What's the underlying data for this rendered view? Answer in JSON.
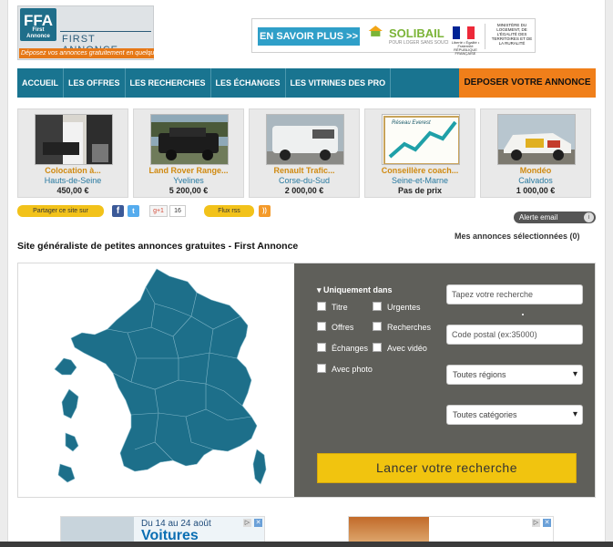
{
  "header": {
    "logo_letters": "FFA",
    "logo_small": "First Annonce",
    "logo_name": "FIRST ANNONCE",
    "logo_tagline": "Déposez vos annonces gratuitement en quelques clics",
    "banner_button": "EN SAVOIR PLUS >>",
    "banner_brand": "SOLIBAIL",
    "banner_brand_sub": "POUR LOGER SANS SOUCI",
    "banner_flag_text": "Liberté • Égalité • Fraternité RÉPUBLIQUE FRANÇAISE",
    "banner_ministry": "MINISTÈRE DU LOGEMENT, DE L'ÉGALITÉ DES TERRITOIRES ET DE LA RURALITÉ"
  },
  "nav": {
    "items": [
      "ACCUEIL",
      "LES OFFRES",
      "LES RECHERCHES",
      "LES ÉCHANGES",
      "LES VITRINES DES PRO"
    ],
    "cta": "DEPOSER VOTRE ANNONCE"
  },
  "listings": [
    {
      "title": "Colocation à...",
      "region": "Hauts-de-Seine",
      "price": "450,00 €"
    },
    {
      "title": "Land Rover Range...",
      "region": "Yvelines",
      "price": "5 200,00 €"
    },
    {
      "title": "Renault Trafic...",
      "region": "Corse-du-Sud",
      "price": "2 000,00 €"
    },
    {
      "title": "Conseillère coach...",
      "region": "Seine-et-Marne",
      "price": "Pas de prix"
    },
    {
      "title": "Mondéo",
      "region": "Calvados",
      "price": "1 000,00 €"
    }
  ],
  "listing_image_text": "Réseau Everest",
  "share": {
    "share_label": "Partager ce site sur",
    "fb": "f",
    "tw": "t",
    "gplus": "g+1",
    "gplus_count": "16",
    "rss_label": "Flux rss",
    "alert_label": "Alerte email",
    "alert_icon": "i"
  },
  "selected_link": "Mes annonces sélectionnées (0)",
  "page_title": "Site généraliste de petites annonces gratuites - First Annonce",
  "search": {
    "only_label": "Uniquement dans",
    "checkboxes": [
      "Titre",
      "Urgentes",
      "Offres",
      "Recherches",
      "Échanges",
      "Avec vidéo",
      "Avec photo"
    ],
    "query_placeholder": "Tapez votre recherche",
    "postal_placeholder": "Code postal (ex:35000)",
    "region_select": "Toutes régions",
    "category_select": "Toutes catégories",
    "submit_label": "Lancer votre recherche"
  },
  "ads": {
    "left_date": "Du 14 au 24 août",
    "left_word": "Voitures",
    "close": "✕",
    "info": "▷"
  },
  "colors": {
    "nav_bg": "#197490",
    "cta_bg": "#f07f1a",
    "map_fill": "#1d6f8a",
    "search_button": "#f1c40f",
    "filter_panel": "#5f5f5a"
  }
}
